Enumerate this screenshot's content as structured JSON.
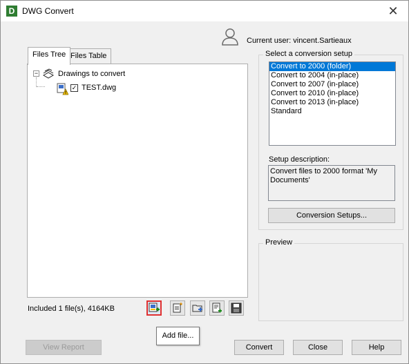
{
  "window": {
    "title": "DWG Convert",
    "close_glyph": "✕",
    "app_icon_letter": "D"
  },
  "user": {
    "label": "Current user: vincent.Sartieaux"
  },
  "tabs": [
    {
      "label": "Files Tree",
      "active": true
    },
    {
      "label": "Files Table",
      "active": false
    }
  ],
  "tree": {
    "root": {
      "label": "Drawings to convert",
      "expander": "−"
    },
    "file": {
      "label": "TEST.dwg",
      "checked": true,
      "check_glyph": "✓"
    }
  },
  "status": {
    "included": "Included 1 file(s), 4164KB"
  },
  "toolbar": {
    "buttons": [
      "add-file",
      "add-sheet-set",
      "add-folder",
      "append-list",
      "save-list"
    ],
    "tooltip": "Add file..."
  },
  "setup": {
    "group_title": "Select a conversion setup",
    "items": [
      {
        "label": "Convert to 2000 (folder)",
        "selected": true
      },
      {
        "label": "Convert to 2004 (in-place)",
        "selected": false
      },
      {
        "label": "Convert to 2007 (in-place)",
        "selected": false
      },
      {
        "label": "Convert to 2010 (in-place)",
        "selected": false
      },
      {
        "label": "Convert to 2013 (in-place)",
        "selected": false
      },
      {
        "label": "Standard",
        "selected": false
      }
    ],
    "description_label": "Setup description:",
    "description": "Convert files to 2000 format 'My Documents'",
    "conversion_setups_button": "Conversion Setups..."
  },
  "preview": {
    "group_title": "Preview"
  },
  "buttons": {
    "view_report": "View Report",
    "convert": "Convert",
    "close": "Close",
    "help": "Help"
  },
  "colors": {
    "selection": "#0078d7",
    "highlight_border": "#e03030"
  }
}
